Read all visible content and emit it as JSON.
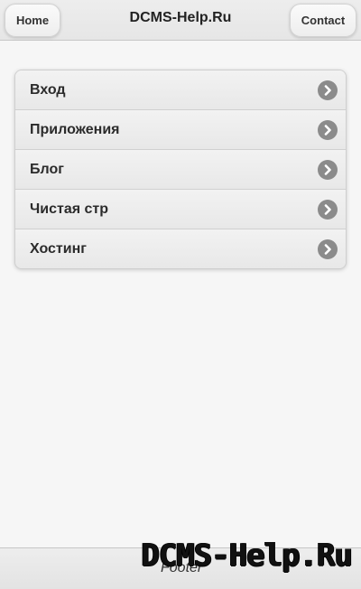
{
  "header": {
    "title": "DCMS-Help.Ru",
    "left_button": "Home",
    "right_button": "Contact"
  },
  "menu": {
    "items": [
      {
        "label": "Вход",
        "icon": "chevron-right-circle-icon"
      },
      {
        "label": "Приложения",
        "icon": "chevron-right-circle-icon"
      },
      {
        "label": "Блог",
        "icon": "chevron-right-circle-icon"
      },
      {
        "label": "Чистая стр",
        "icon": "chevron-right-circle-icon"
      },
      {
        "label": "Хостинг",
        "icon": "chevron-right-circle-icon"
      }
    ]
  },
  "footer": {
    "text": "Footer",
    "watermark": "DCMS-Help.Ru"
  },
  "colors": {
    "background": "#f6f6f6",
    "bar": "#e9e9e9",
    "arrow": "#8b8b8b",
    "text": "#2b2b2b"
  }
}
